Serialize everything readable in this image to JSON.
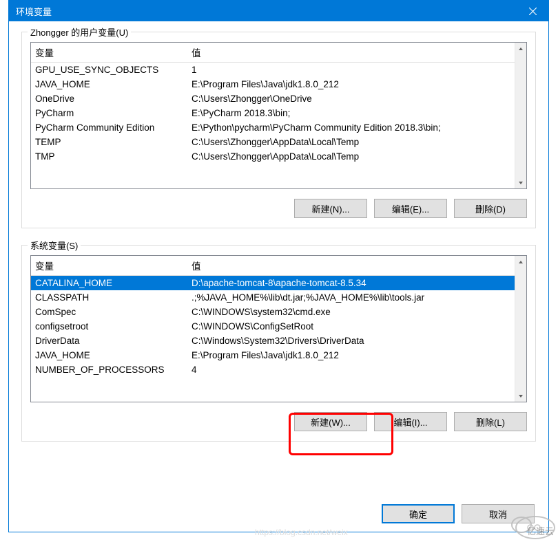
{
  "window": {
    "title": "环境变量",
    "close_icon": "close"
  },
  "userSection": {
    "legend": "Zhongger 的用户变量(U)",
    "headers": {
      "name": "变量",
      "value": "值"
    },
    "rows": [
      {
        "name": "GPU_USE_SYNC_OBJECTS",
        "value": "1"
      },
      {
        "name": "JAVA_HOME",
        "value": "E:\\Program Files\\Java\\jdk1.8.0_212"
      },
      {
        "name": "OneDrive",
        "value": "C:\\Users\\Zhongger\\OneDrive"
      },
      {
        "name": "PyCharm",
        "value": "E:\\PyCharm 2018.3\\bin;"
      },
      {
        "name": "PyCharm Community Edition",
        "value": "E:\\Python\\pycharm\\PyCharm Community Edition 2018.3\\bin;"
      },
      {
        "name": "TEMP",
        "value": "C:\\Users\\Zhongger\\AppData\\Local\\Temp"
      },
      {
        "name": "TMP",
        "value": "C:\\Users\\Zhongger\\AppData\\Local\\Temp"
      }
    ],
    "buttons": {
      "new": "新建(N)...",
      "edit": "编辑(E)...",
      "delete": "删除(D)"
    }
  },
  "systemSection": {
    "legend": "系统变量(S)",
    "headers": {
      "name": "变量",
      "value": "值"
    },
    "rows": [
      {
        "name": "CATALINA_HOME",
        "value": "D:\\apache-tomcat-8\\apache-tomcat-8.5.34",
        "selected": true
      },
      {
        "name": "CLASSPATH",
        "value": ".;%JAVA_HOME%\\lib\\dt.jar;%JAVA_HOME%\\lib\\tools.jar"
      },
      {
        "name": "ComSpec",
        "value": "C:\\WINDOWS\\system32\\cmd.exe"
      },
      {
        "name": "configsetroot",
        "value": "C:\\WINDOWS\\ConfigSetRoot"
      },
      {
        "name": "DriverData",
        "value": "C:\\Windows\\System32\\Drivers\\DriverData"
      },
      {
        "name": "JAVA_HOME",
        "value": "E:\\Program Files\\Java\\jdk1.8.0_212"
      },
      {
        "name": "NUMBER_OF_PROCESSORS",
        "value": "4"
      }
    ],
    "buttons": {
      "new": "新建(W)...",
      "edit": "编辑(I)...",
      "delete": "删除(L)"
    }
  },
  "mainButtons": {
    "ok": "确定",
    "cancel": "取消"
  },
  "watermark": {
    "text": "亿速云",
    "faded": "https://blog.csdn.net/weix"
  }
}
